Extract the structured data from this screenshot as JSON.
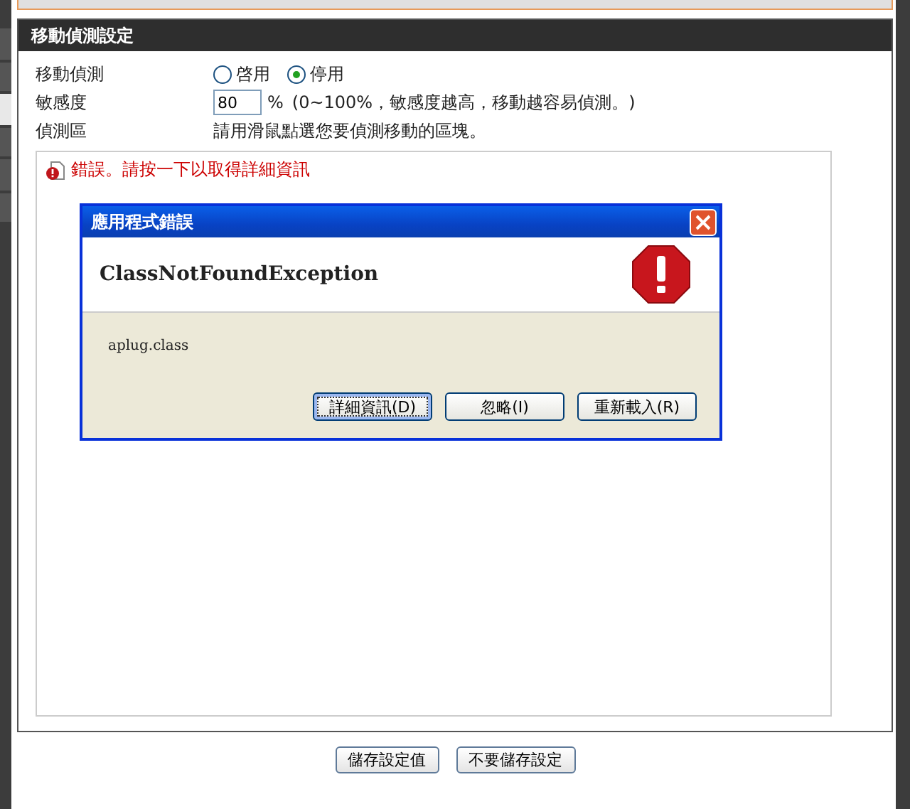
{
  "side_tabs": [
    {
      "selected": false
    },
    {
      "selected": false
    },
    {
      "selected": true
    },
    {
      "selected": false
    },
    {
      "selected": false
    },
    {
      "selected": false
    }
  ],
  "section": {
    "title": "移動偵測設定"
  },
  "rows": [
    {
      "kind": "radio",
      "label": "移動偵測",
      "options": [
        {
          "label": "啓用",
          "selected": false
        },
        {
          "label": "停用",
          "selected": true
        }
      ]
    },
    {
      "kind": "input",
      "label": "敏感度",
      "value": "80",
      "unit": "%",
      "hint": "(0~100%，敏感度越高，移動越容易偵測。)"
    },
    {
      "kind": "text",
      "label": "偵測區",
      "text": "請用滑鼠點選您要偵測移動的區塊。"
    }
  ],
  "applet": {
    "error": "錯誤。請按一下以取得詳細資訊"
  },
  "dialog": {
    "title": "應用程式錯誤",
    "heading": "ClassNotFoundException",
    "message": "aplug.class",
    "buttons": [
      {
        "label": "詳細資訊(D)",
        "focused": true
      },
      {
        "label": "忽略(I)",
        "focused": false
      },
      {
        "label": "重新載入(R)",
        "focused": false
      }
    ]
  },
  "buttons": [
    "儲存設定值",
    "不要儲存設定"
  ]
}
